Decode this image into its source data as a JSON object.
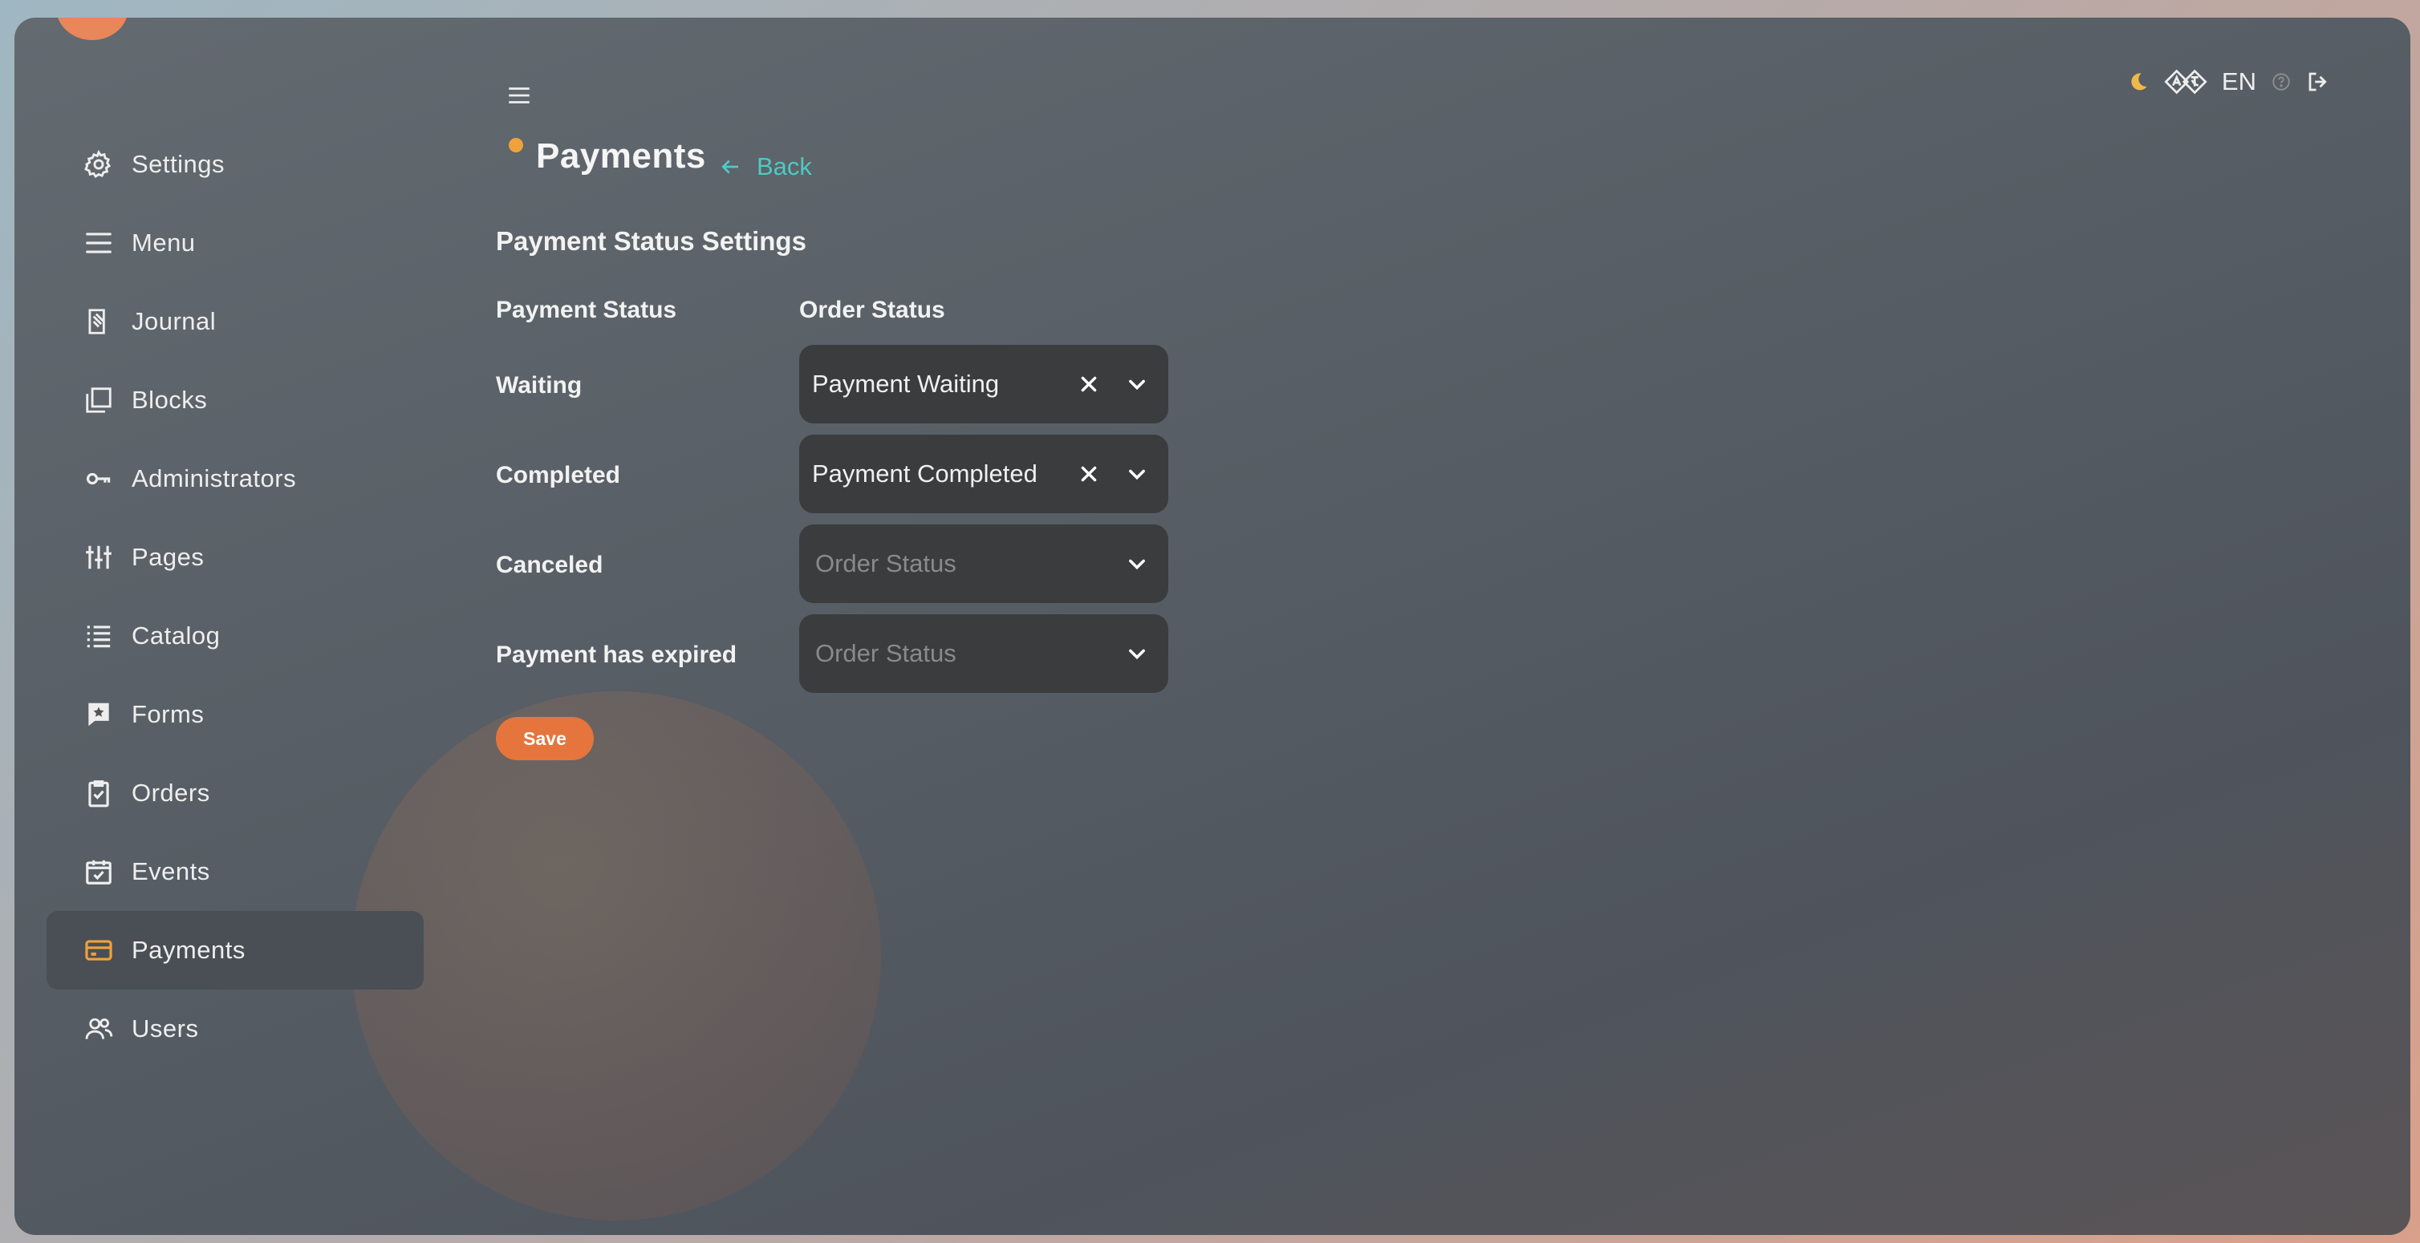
{
  "sidebar": {
    "items": [
      {
        "label": "Settings",
        "icon": "gear-icon"
      },
      {
        "label": "Menu",
        "icon": "menu-icon"
      },
      {
        "label": "Journal",
        "icon": "journal-icon"
      },
      {
        "label": "Blocks",
        "icon": "blocks-icon"
      },
      {
        "label": "Administrators",
        "icon": "key-icon"
      },
      {
        "label": "Pages",
        "icon": "sliders-icon"
      },
      {
        "label": "Catalog",
        "icon": "list-icon"
      },
      {
        "label": "Forms",
        "icon": "form-icon"
      },
      {
        "label": "Orders",
        "icon": "clipboard-check-icon"
      },
      {
        "label": "Events",
        "icon": "calendar-check-icon"
      },
      {
        "label": "Payments",
        "icon": "credit-card-icon",
        "active": true
      },
      {
        "label": "Users",
        "icon": "users-icon"
      }
    ]
  },
  "header": {
    "title": "Payments",
    "back_label": "Back",
    "language": "EN",
    "tools": [
      "moon-icon",
      "translate-icon",
      "help-icon",
      "logout-icon"
    ]
  },
  "form": {
    "section_title": "Payment Status Settings",
    "col_payment_status": "Payment Status",
    "col_order_status": "Order Status",
    "rows": [
      {
        "label": "Waiting",
        "value": "Payment Waiting",
        "placeholder": "Order Status"
      },
      {
        "label": "Completed",
        "value": "Payment Completed",
        "placeholder": "Order Status"
      },
      {
        "label": "Canceled",
        "value": "",
        "placeholder": "Order Status"
      },
      {
        "label": "Payment has expired",
        "value": "",
        "placeholder": "Order Status"
      }
    ],
    "save_label": "Save"
  },
  "colors": {
    "accent": "#e5753c",
    "link": "#4fc9c4",
    "active_icon": "#f0a23a"
  }
}
